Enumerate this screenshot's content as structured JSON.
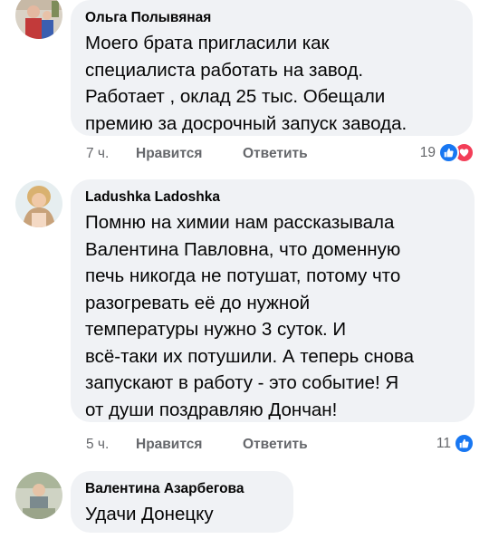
{
  "comments": [
    {
      "author": "Ольга Полывяная",
      "lines": [
        "Моего брата пригласили как",
        "специалиста работать на завод.",
        "Работает , оклад 25 тыс. Обещали",
        "премию за досрочный запуск завода."
      ],
      "time": "7 ч.",
      "like_label": "Нравится",
      "reply_label": "Ответить",
      "reaction_count": "19",
      "reaction_icons": [
        "like-icon",
        "love-icon"
      ]
    },
    {
      "author": "Ladushka Ladoshka",
      "lines": [
        "Помню на химии нам рассказывала",
        "Валентина Павловна, что доменную",
        "печь никогда не потушат, потому что",
        "разогревать её до нужной",
        "температуры нужно 3 суток. И",
        "всё-таки их потушили. А теперь снова",
        "запускают в работу - это событие! Я",
        "от души поздравляю Дончан!"
      ],
      "time": "5 ч.",
      "like_label": "Нравится",
      "reply_label": "Ответить",
      "reaction_count": "11",
      "reaction_icons": [
        "like-icon"
      ]
    },
    {
      "author": "Валентина Азарбегова",
      "lines": [
        "Удачи Донецку"
      ]
    }
  ],
  "colors": {
    "bubble": "#f0f2f5",
    "secondary_text": "#65676b",
    "like": "#1877f2",
    "love": "#f33e58"
  }
}
